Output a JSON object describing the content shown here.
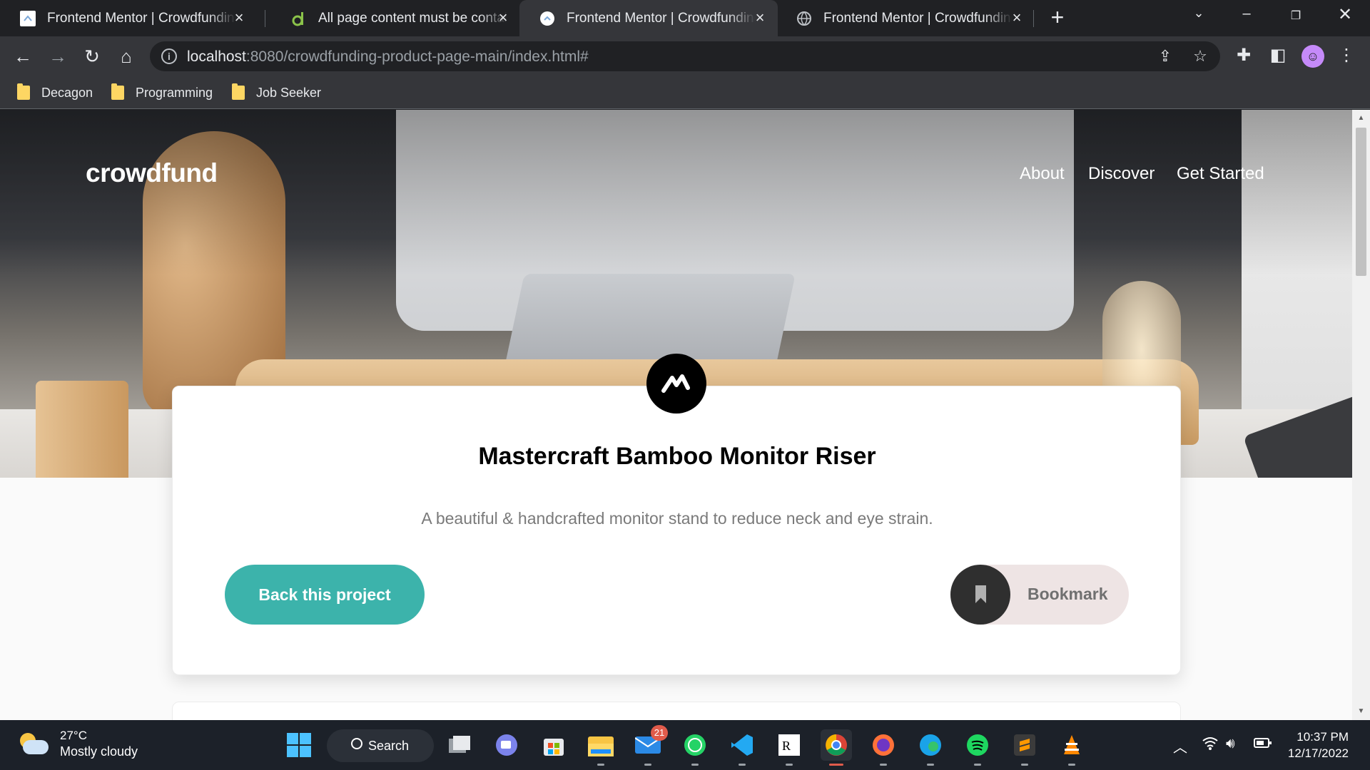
{
  "browser": {
    "tabs": [
      {
        "title": "Frontend Mentor | Crowdfunding",
        "active": false
      },
      {
        "title": "All page content must be contain",
        "active": false
      },
      {
        "title": "Frontend Mentor | Crowdfunding",
        "active": true
      },
      {
        "title": "Frontend Mentor | Crowdfunding",
        "active": false
      }
    ],
    "url_host": "localhost",
    "url_rest": ":8080/crowdfunding-product-page-main/index.html#",
    "bookmarks": [
      "Decagon",
      "Programming",
      "Job Seeker"
    ]
  },
  "page": {
    "logo": "crowdfund",
    "nav": [
      "About",
      "Discover",
      "Get Started"
    ],
    "card": {
      "title": "Mastercraft Bamboo Monitor Riser",
      "subtitle": "A beautiful & handcrafted monitor stand to reduce neck and eye strain.",
      "back_button": "Back this project",
      "bookmark_button": "Bookmark"
    },
    "colors": {
      "accent": "#3cb3ab",
      "dark": "#2f2f2f"
    }
  },
  "taskbar": {
    "weather_temp": "27°C",
    "weather_desc": "Mostly cloudy",
    "search_label": "Search",
    "mail_badge": "21",
    "time": "10:37 PM",
    "date": "12/17/2022"
  }
}
